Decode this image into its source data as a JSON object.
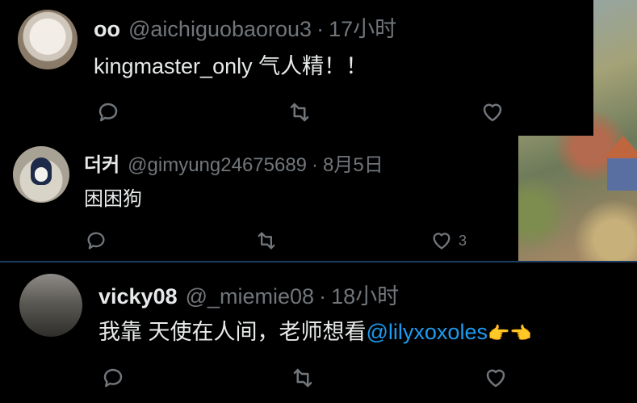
{
  "tweets": [
    {
      "name": "oo",
      "handle": "@aichiguobaorou3",
      "separator": "·",
      "time": "17小时",
      "text": "kingmaster_only 气人精！！",
      "like_count": ""
    },
    {
      "name": "더커",
      "handle": "@gimyung24675689",
      "separator": "·",
      "time": "8月5日",
      "text": "困困狗",
      "like_count": "3"
    },
    {
      "name": "vicky08",
      "handle": "@_miemie08",
      "separator": "·",
      "time": "18小时",
      "text": "我靠 天使在人间，老师想看",
      "mention": "@lilyxoxoles",
      "emoji": "👉👈"
    }
  ],
  "icons": {
    "reply": "reply-icon",
    "retweet": "retweet-icon",
    "like": "heart-icon"
  },
  "colors": {
    "background": "#000000",
    "text": "#e7e9ea",
    "muted": "#71767b",
    "mention": "#1d9bf0"
  }
}
